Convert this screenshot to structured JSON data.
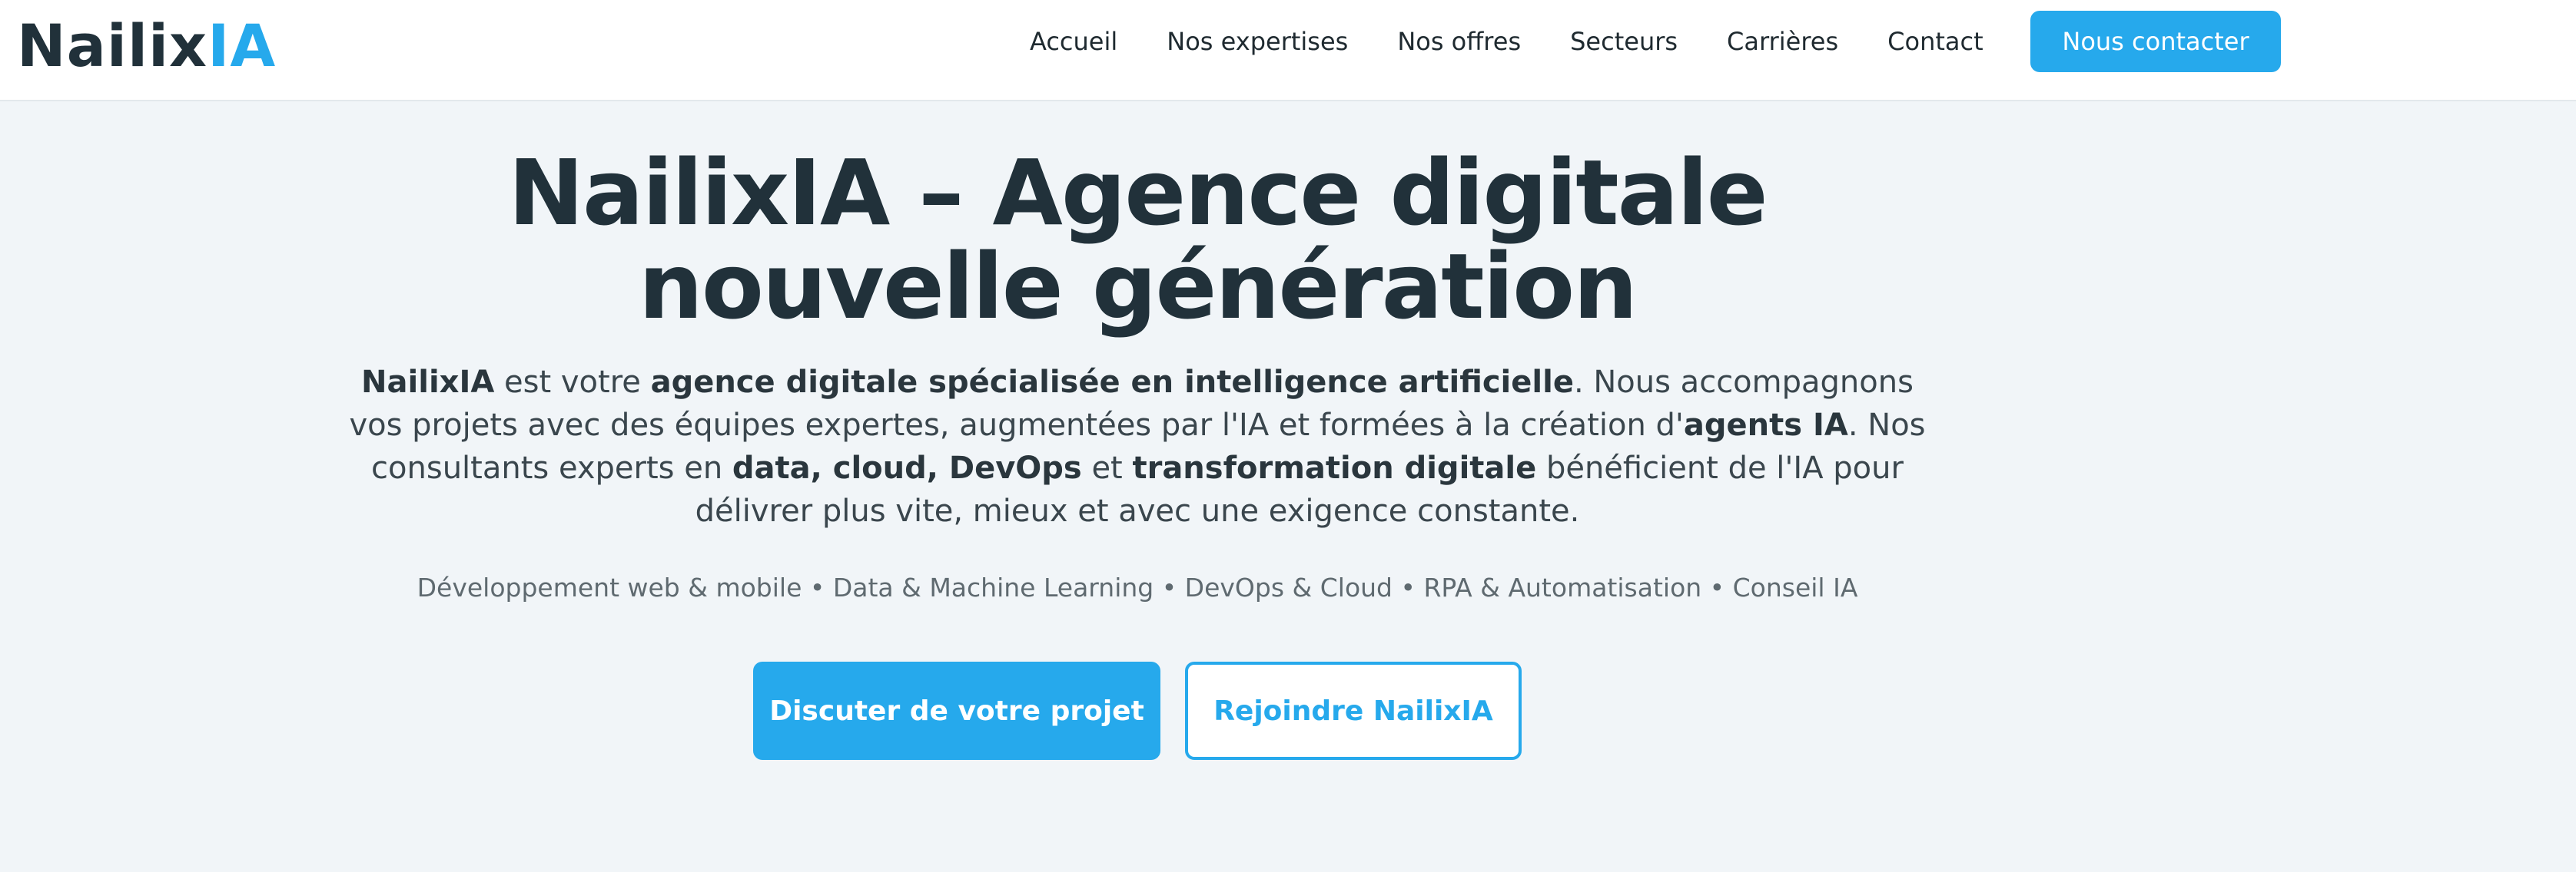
{
  "header": {
    "logo_part1": "Nailix",
    "logo_part2": "IA",
    "nav": [
      {
        "label": "Accueil"
      },
      {
        "label": "Nos expertises"
      },
      {
        "label": "Nos offres"
      },
      {
        "label": "Secteurs"
      },
      {
        "label": "Carrières"
      },
      {
        "label": "Contact"
      }
    ],
    "cta_label": "Nous contacter"
  },
  "hero": {
    "title": "NailixIA – Agence digitale nouvelle génération",
    "desc": {
      "b1": "NailixIA",
      "t1": " est votre ",
      "b2": "agence digitale spécialisée en intelligence artificielle",
      "t2": ". Nous accompagnons vos projets avec des équipes expertes, augmentées par l'IA et formées à la création d'",
      "b3": "agents IA",
      "t3": ". Nos consultants experts en ",
      "b4": "data, cloud, DevOps",
      "t4": " et ",
      "b5": "transformation digitale",
      "t5": " bénéficient de l'IA pour délivrer plus vite, mieux et avec une exigence constante."
    },
    "services": "Développement web & mobile • Data & Machine Learning • DevOps & Cloud • RPA & Automatisation • Conseil IA",
    "primary_button": "Discuter de votre projet",
    "secondary_button": "Rejoindre NailixIA"
  },
  "colors": {
    "accent": "#26a9ec",
    "text_dark": "#21313a",
    "background": "#f1f5f8"
  }
}
